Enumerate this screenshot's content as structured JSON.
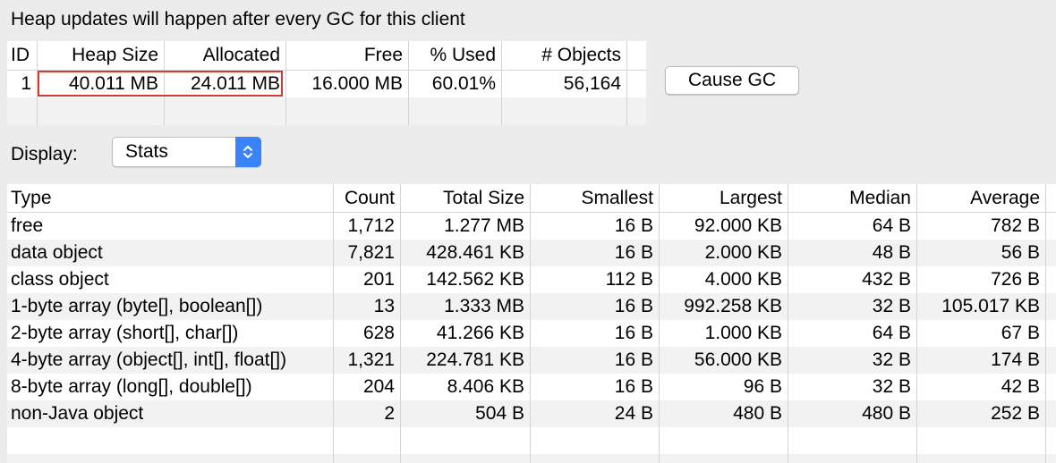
{
  "header": {
    "message": "Heap updates will happen after every GC for this client"
  },
  "heap_table": {
    "columns": [
      "ID",
      "Heap Size",
      "Allocated",
      "Free",
      "% Used",
      "# Objects"
    ],
    "rows": [
      [
        "1",
        "40.011 MB",
        "24.011 MB",
        "16.000 MB",
        "60.01%",
        "56,164"
      ]
    ]
  },
  "cause_gc_label": "Cause GC",
  "display": {
    "label": "Display:",
    "selected": "Stats"
  },
  "stats_table": {
    "columns": [
      "Type",
      "Count",
      "Total Size",
      "Smallest",
      "Largest",
      "Median",
      "Average"
    ],
    "rows": [
      [
        "free",
        "1,712",
        "1.277 MB",
        "16 B",
        "92.000 KB",
        "64 B",
        "782 B"
      ],
      [
        "data object",
        "7,821",
        "428.461 KB",
        "16 B",
        "2.000 KB",
        "48 B",
        "56 B"
      ],
      [
        "class object",
        "201",
        "142.562 KB",
        "112 B",
        "4.000 KB",
        "432 B",
        "726 B"
      ],
      [
        "1-byte array (byte[], boolean[])",
        "13",
        "1.333 MB",
        "16 B",
        "992.258 KB",
        "32 B",
        "105.017 KB"
      ],
      [
        "2-byte array (short[], char[])",
        "628",
        "41.266 KB",
        "16 B",
        "1.000 KB",
        "64 B",
        "67 B"
      ],
      [
        "4-byte array (object[], int[], float[])",
        "1,321",
        "224.781 KB",
        "16 B",
        "56.000 KB",
        "32 B",
        "174 B"
      ],
      [
        "8-byte array (long[], double[])",
        "204",
        "8.406 KB",
        "16 B",
        "96 B",
        "32 B",
        "42 B"
      ],
      [
        "non-Java object",
        "2",
        "504 B",
        "24 B",
        "480 B",
        "480 B",
        "252 B"
      ]
    ]
  },
  "colors": {
    "highlight": "#d43a2f",
    "stepper": "#3a82f7",
    "stripe": "#f2f2f2"
  }
}
